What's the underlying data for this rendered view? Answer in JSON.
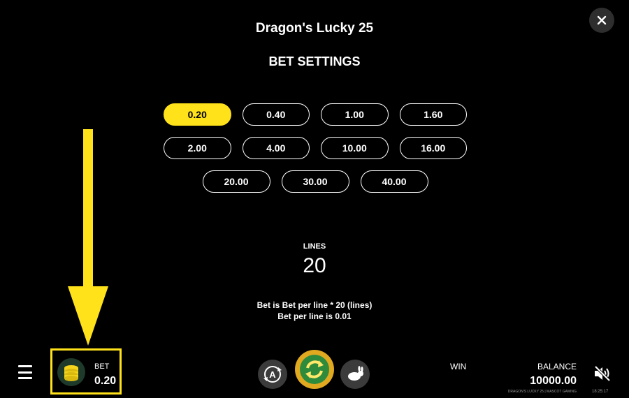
{
  "game_title": "Dragon's Lucky 25",
  "settings_title": "BET SETTINGS",
  "bet_options": {
    "row1": [
      "0.20",
      "0.40",
      "1.00",
      "1.60"
    ],
    "row2": [
      "2.00",
      "4.00",
      "10.00",
      "16.00"
    ],
    "row3": [
      "20.00",
      "30.00",
      "40.00"
    ],
    "selected": "0.20"
  },
  "lines": {
    "label": "LINES",
    "value": "20"
  },
  "info": {
    "line1": "Bet is Bet per line * 20 (lines)",
    "line2": "Bet per line is 0.01"
  },
  "bottom_bar": {
    "bet_label": "BET",
    "bet_value": "0.20",
    "win_label": "WIN",
    "balance_label": "BALANCE",
    "balance_value": "10000.00",
    "footer": "DRAGON'S LUCKY 25 | MASCOT GAMING",
    "clock": "18:25:17"
  },
  "icons": {
    "close": "close-icon",
    "menu": "menu-icon",
    "coins": "coins-icon",
    "autoplay": "autoplay-icon",
    "spin": "spin-icon",
    "turbo": "turbo-icon",
    "sound": "sound-muted-icon"
  },
  "colors": {
    "accent": "#ffe21a",
    "background": "#000000",
    "spin": "#e0a920",
    "spin_inner": "#2e8b3c"
  }
}
